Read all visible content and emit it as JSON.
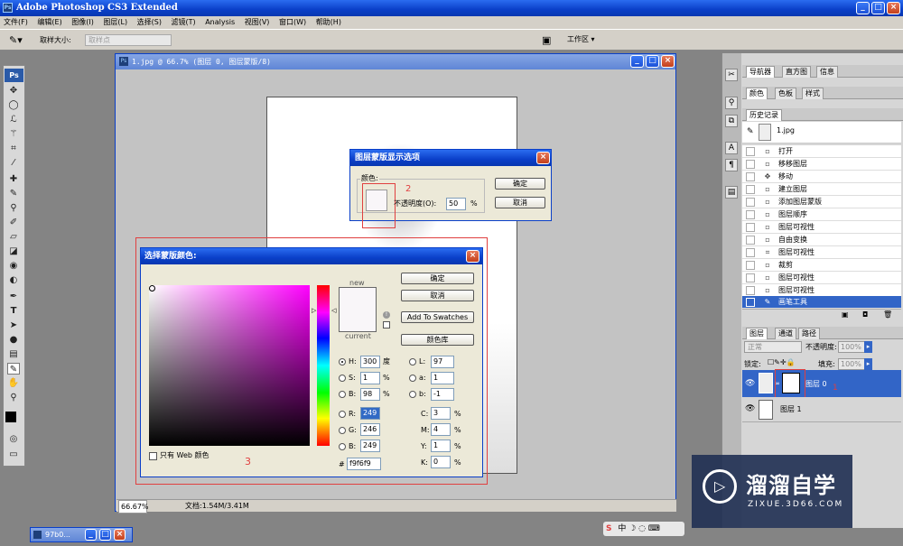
{
  "app": {
    "title": "Adobe Photoshop CS3 Extended"
  },
  "menu": [
    "文件(F)",
    "编辑(E)",
    "图像(I)",
    "图层(L)",
    "选择(S)",
    "滤镜(T)",
    "Analysis",
    "视图(V)",
    "窗口(W)",
    "帮助(H)"
  ],
  "options": {
    "sample_label": "取样大小:",
    "sample_value": "取样点",
    "workspace_label": "工作区 ▾"
  },
  "tools": [
    "move-icon",
    "marquee-icon",
    "lasso-icon",
    "magic-wand-icon",
    "crop-icon",
    "slice-icon",
    "healing-icon",
    "brush-icon",
    "stamp-icon",
    "history-brush-icon",
    "eraser-icon",
    "gradient-icon",
    "blur-icon",
    "dodge-icon",
    "pen-icon",
    "type-icon",
    "path-select-icon",
    "shape-icon",
    "notes-icon",
    "eyedropper-icon",
    "hand-icon",
    "zoom-icon"
  ],
  "document": {
    "title": "1.jpg @ 66.7% (图层 0, 图层蒙版/8)",
    "zoom": "66.67%",
    "doc_info": "文档:1.54M/3.41M"
  },
  "mask_dialog": {
    "title": "图层蒙版显示选项",
    "color_label": "颜色:",
    "opacity_label": "不透明度(O):",
    "opacity_value": "50",
    "percent": "%",
    "ok": "确定",
    "cancel": "取消",
    "annotation": "2"
  },
  "picker": {
    "title": "选择蒙版颜色:",
    "new_label": "new",
    "current_label": "current",
    "ok": "确定",
    "cancel": "取消",
    "swatches": "Add To Swatches",
    "libraries": "颜色库",
    "web_only": "只有 Web 颜色",
    "annotation": "3",
    "hsb": [
      {
        "l": "H:",
        "v": "300",
        "u": "度"
      },
      {
        "l": "S:",
        "v": "1",
        "u": "%"
      },
      {
        "l": "B:",
        "v": "98",
        "u": "%"
      }
    ],
    "rgb": [
      {
        "l": "R:",
        "v": "249"
      },
      {
        "l": "G:",
        "v": "246"
      },
      {
        "l": "B:",
        "v": "249"
      }
    ],
    "lab": [
      {
        "l": "L:",
        "v": "97"
      },
      {
        "l": "a:",
        "v": "1"
      },
      {
        "l": "b:",
        "v": "-1"
      }
    ],
    "cmyk": [
      {
        "l": "C:",
        "v": "3"
      },
      {
        "l": "M:",
        "v": "4"
      },
      {
        "l": "Y:",
        "v": "1"
      },
      {
        "l": "K:",
        "v": "0"
      }
    ],
    "hex": "f9f6f9",
    "color": "#f9f6f9"
  },
  "panels": {
    "top_tabs": [
      "导航器",
      "直方图",
      "信息"
    ],
    "color_tabs": [
      "颜色",
      "色板",
      "样式"
    ],
    "history_tab": "历史记录",
    "history_snapshot": "1.jpg",
    "history": [
      "打开",
      "移移图层",
      "移动",
      "建立图层",
      "添加图层蒙版",
      "图层顺序",
      "图层可视性",
      "自由变换",
      "图层可视性",
      "裁剪",
      "图层可视性",
      "图层可视性",
      "图层可视性",
      "画笔工具"
    ],
    "layer_tabs": [
      "图层",
      "通道",
      "路径"
    ],
    "blend": "正常",
    "opacity_label": "不透明度:",
    "opacity": "100%",
    "lock_label": "锁定:",
    "fill_label": "填充:",
    "fill": "100%",
    "layers": [
      {
        "name": "图层 0",
        "note": "1"
      },
      {
        "name": "图层 1",
        "note": ""
      }
    ]
  },
  "taskbar": {
    "item": "97b0..."
  },
  "watermark": {
    "brand": "溜溜自学",
    "url": "ZIXUE.3D66.COM"
  }
}
